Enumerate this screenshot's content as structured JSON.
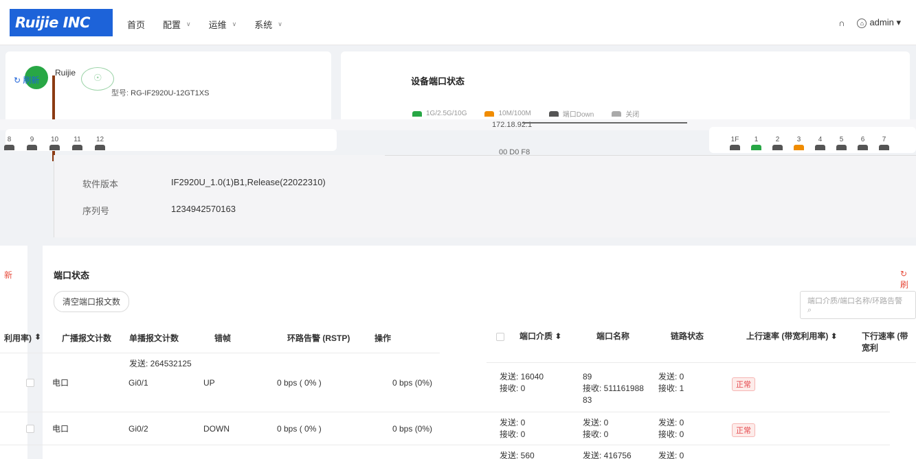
{
  "header": {
    "logo": "Ruijie INC",
    "nav": [
      {
        "label": "首页"
      },
      {
        "label": "配置",
        "dropdown": true
      },
      {
        "label": "运维",
        "dropdown": true
      },
      {
        "label": "系统",
        "dropdown": true
      }
    ],
    "user": "admin"
  },
  "device": {
    "brand": "Ruijie",
    "refresh_label": "刷新",
    "model_label": "型号:",
    "model_value": "RG-IF2920U-12GT1XS",
    "software_label": "软件版本",
    "software_value": "IF2920U_1.0(1)B1,Release(22022310)",
    "serial_label": "序列号",
    "serial_value": "1234942570163",
    "ip_fragment": "172.18.92.1",
    "mac_fragment": "00 D0 F8",
    "left_ports": [
      "8",
      "9",
      "10",
      "11",
      "12"
    ]
  },
  "port_panel": {
    "title": "设备端口状态",
    "legend": [
      {
        "label": "1G/2.5G/10G",
        "color": "#28a745"
      },
      {
        "label": "10M/100M",
        "color": "#f08c00"
      },
      {
        "label": "端口Down",
        "color": "#555555"
      },
      {
        "label": "关闭",
        "color": "#aaaaaa"
      }
    ],
    "ports": [
      {
        "label": "1F",
        "color": "#555555"
      },
      {
        "label": "1",
        "color": "#28a745"
      },
      {
        "label": "2",
        "color": "#555555"
      },
      {
        "label": "3",
        "color": "#f08c00"
      },
      {
        "label": "4",
        "color": "#555555"
      },
      {
        "label": "5",
        "color": "#555555"
      },
      {
        "label": "6",
        "color": "#555555"
      },
      {
        "label": "7",
        "color": "#555555"
      }
    ]
  },
  "port_status": {
    "title": "端口状态",
    "refresh_left": "新",
    "refresh_right": "刷",
    "clear_button": "清空端口报文数",
    "search_placeholder": "端口介质/端口名称/环路告警",
    "left_columns": [
      "利用率)",
      "广播报文计数",
      "单播报文计数",
      "错帧",
      "环路告警 (RSTP)",
      "操作"
    ],
    "right_columns": [
      "端口介质",
      "端口名称",
      "链路状态",
      "上行速率 (带宽利用率)",
      "下行速率 (带宽利"
    ],
    "partial_cell": "发送: 264532125",
    "rows": [
      {
        "medium": "电口",
        "name": "Gi0/1",
        "link": "UP",
        "up_rate": "0 bps ( 0% )",
        "down_rate": "0 bps (0%)",
        "c1_send": "发送: 16040",
        "c1_recv": "接收: 0",
        "c2_send": "89",
        "c2_recv": "接收: 511161988",
        "c2_cont": "83",
        "c3_send": "发送: 0",
        "c3_recv": "接收: 1",
        "alarm": "正常"
      },
      {
        "medium": "电口",
        "name": "Gi0/2",
        "link": "DOWN",
        "up_rate": "0 bps ( 0% )",
        "down_rate": "0 bps (0%)",
        "c1_send": "发送: 0",
        "c1_recv": "接收: 0",
        "c2_send": "发送: 0",
        "c2_recv": "接收: 0",
        "c2_cont": "",
        "c3_send": "发送: 0",
        "c3_recv": "接收: 0",
        "alarm": "正常"
      },
      {
        "medium": "",
        "name": "",
        "link": "",
        "up_rate": "",
        "down_rate": "",
        "c1_send": "发送: 560",
        "c1_recv": "",
        "c2_send": "发送: 416756",
        "c2_recv": "",
        "c2_cont": "",
        "c3_send": "发送: 0",
        "c3_recv": "",
        "alarm": ""
      }
    ]
  }
}
